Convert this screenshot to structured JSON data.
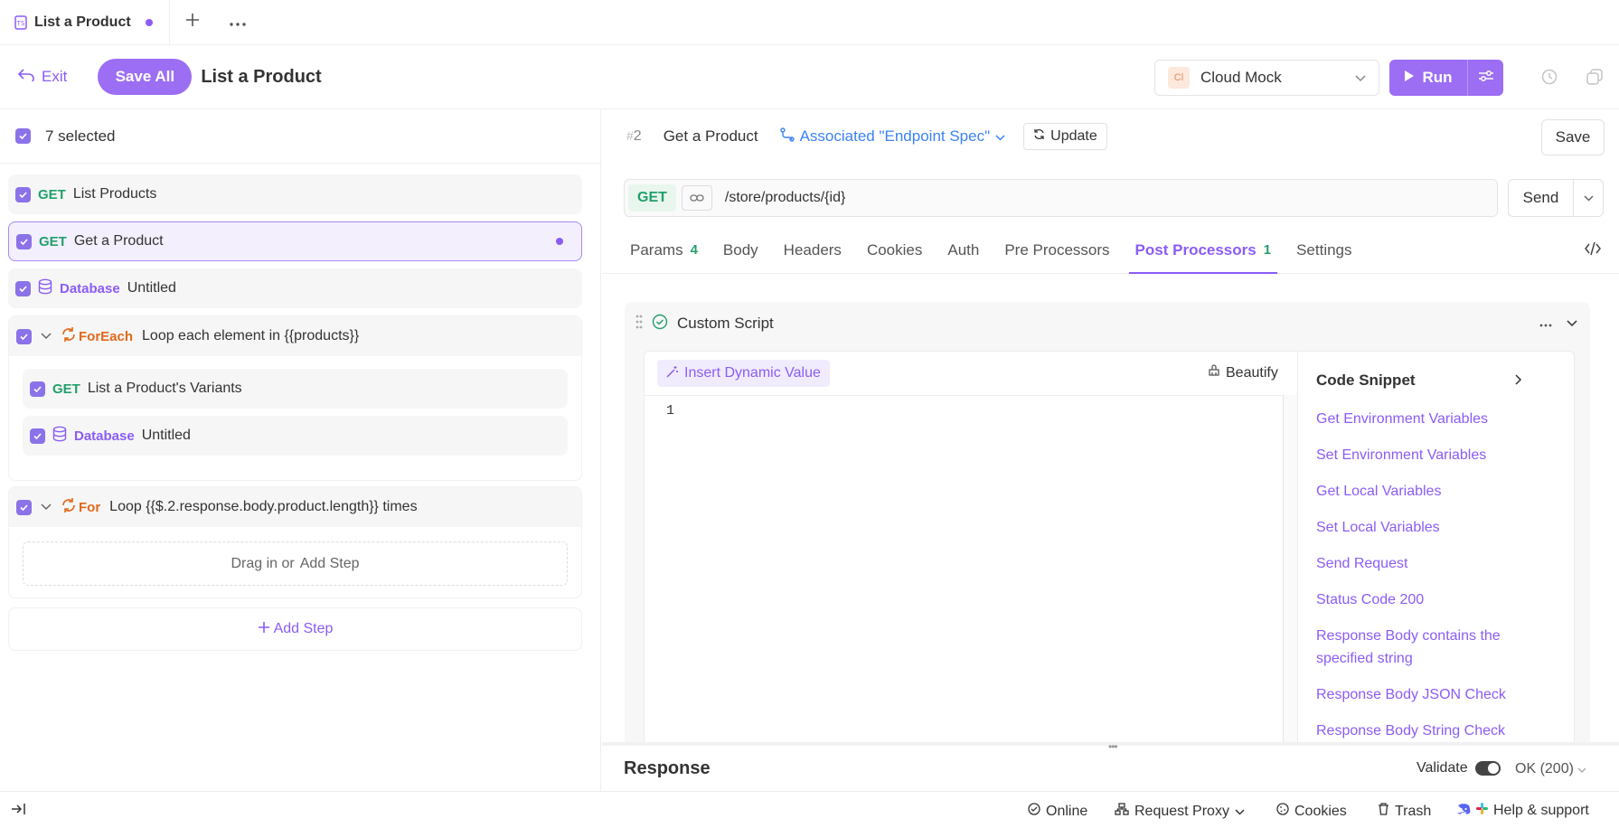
{
  "tabs": [
    {
      "label": "List a Product",
      "unsaved": true
    }
  ],
  "header": {
    "exit_label": "Exit",
    "save_all_label": "Save All",
    "title": "List a Product",
    "environment": {
      "badge": "Cl",
      "name": "Cloud Mock"
    },
    "run_label": "Run"
  },
  "left": {
    "selected_label": "7 selected",
    "steps": [
      {
        "method": "GET",
        "name": "List Products"
      },
      {
        "method": "GET",
        "name": "Get a Product"
      },
      {
        "type": "Database",
        "name": "Untitled"
      }
    ],
    "foreach": {
      "type": "ForEach",
      "label": "Loop each element in {{products}}",
      "children": [
        {
          "method": "GET",
          "name": "List a Product's Variants"
        },
        {
          "type": "Database",
          "name": "Untitled"
        }
      ]
    },
    "for_loop": {
      "type": "For",
      "label": "Loop {{$.2.response.body.product.length}} times",
      "drop_text": "Drag in or",
      "drop_add": "Add Step"
    },
    "add_step_label": "Add Step"
  },
  "request": {
    "index": "2",
    "name": "Get a Product",
    "associated_label": "Associated \"Endpoint Spec\"",
    "update_label": "Update",
    "save_label": "Save",
    "method": "GET",
    "url": "/store/products/{id}",
    "send_label": "Send",
    "tabs": [
      {
        "label": "Params",
        "count": "4"
      },
      {
        "label": "Body",
        "count": ""
      },
      {
        "label": "Headers",
        "count": ""
      },
      {
        "label": "Cookies",
        "count": ""
      },
      {
        "label": "Auth",
        "count": ""
      },
      {
        "label": "Pre Processors",
        "count": ""
      },
      {
        "label": "Post Processors",
        "count": "1"
      },
      {
        "label": "Settings",
        "count": ""
      }
    ],
    "active_tab": "Post Processors"
  },
  "script": {
    "title": "Custom Script",
    "insert_label": "Insert Dynamic Value",
    "beautify_label": "Beautify",
    "line_number": "1",
    "snippet_title": "Code Snippet",
    "snippets": [
      "Get Environment Variables",
      "Set Environment Variables",
      "Get Local Variables",
      "Set Local Variables",
      "Send Request",
      "Status Code 200",
      "Response Body contains the specified string",
      "Response Body JSON Check",
      "Response Body String Check"
    ]
  },
  "response": {
    "title": "Response",
    "validate_label": "Validate",
    "validate_on": true,
    "status": "OK (200)"
  },
  "statusbar": {
    "online": "Online",
    "proxy": "Request Proxy",
    "cookies": "Cookies",
    "trash": "Trash",
    "help": "Help & support"
  },
  "colors": {
    "accent": "#8b5cf6",
    "get": "#22a06b",
    "loop": "#e0691a",
    "link": "#3b82f6"
  }
}
